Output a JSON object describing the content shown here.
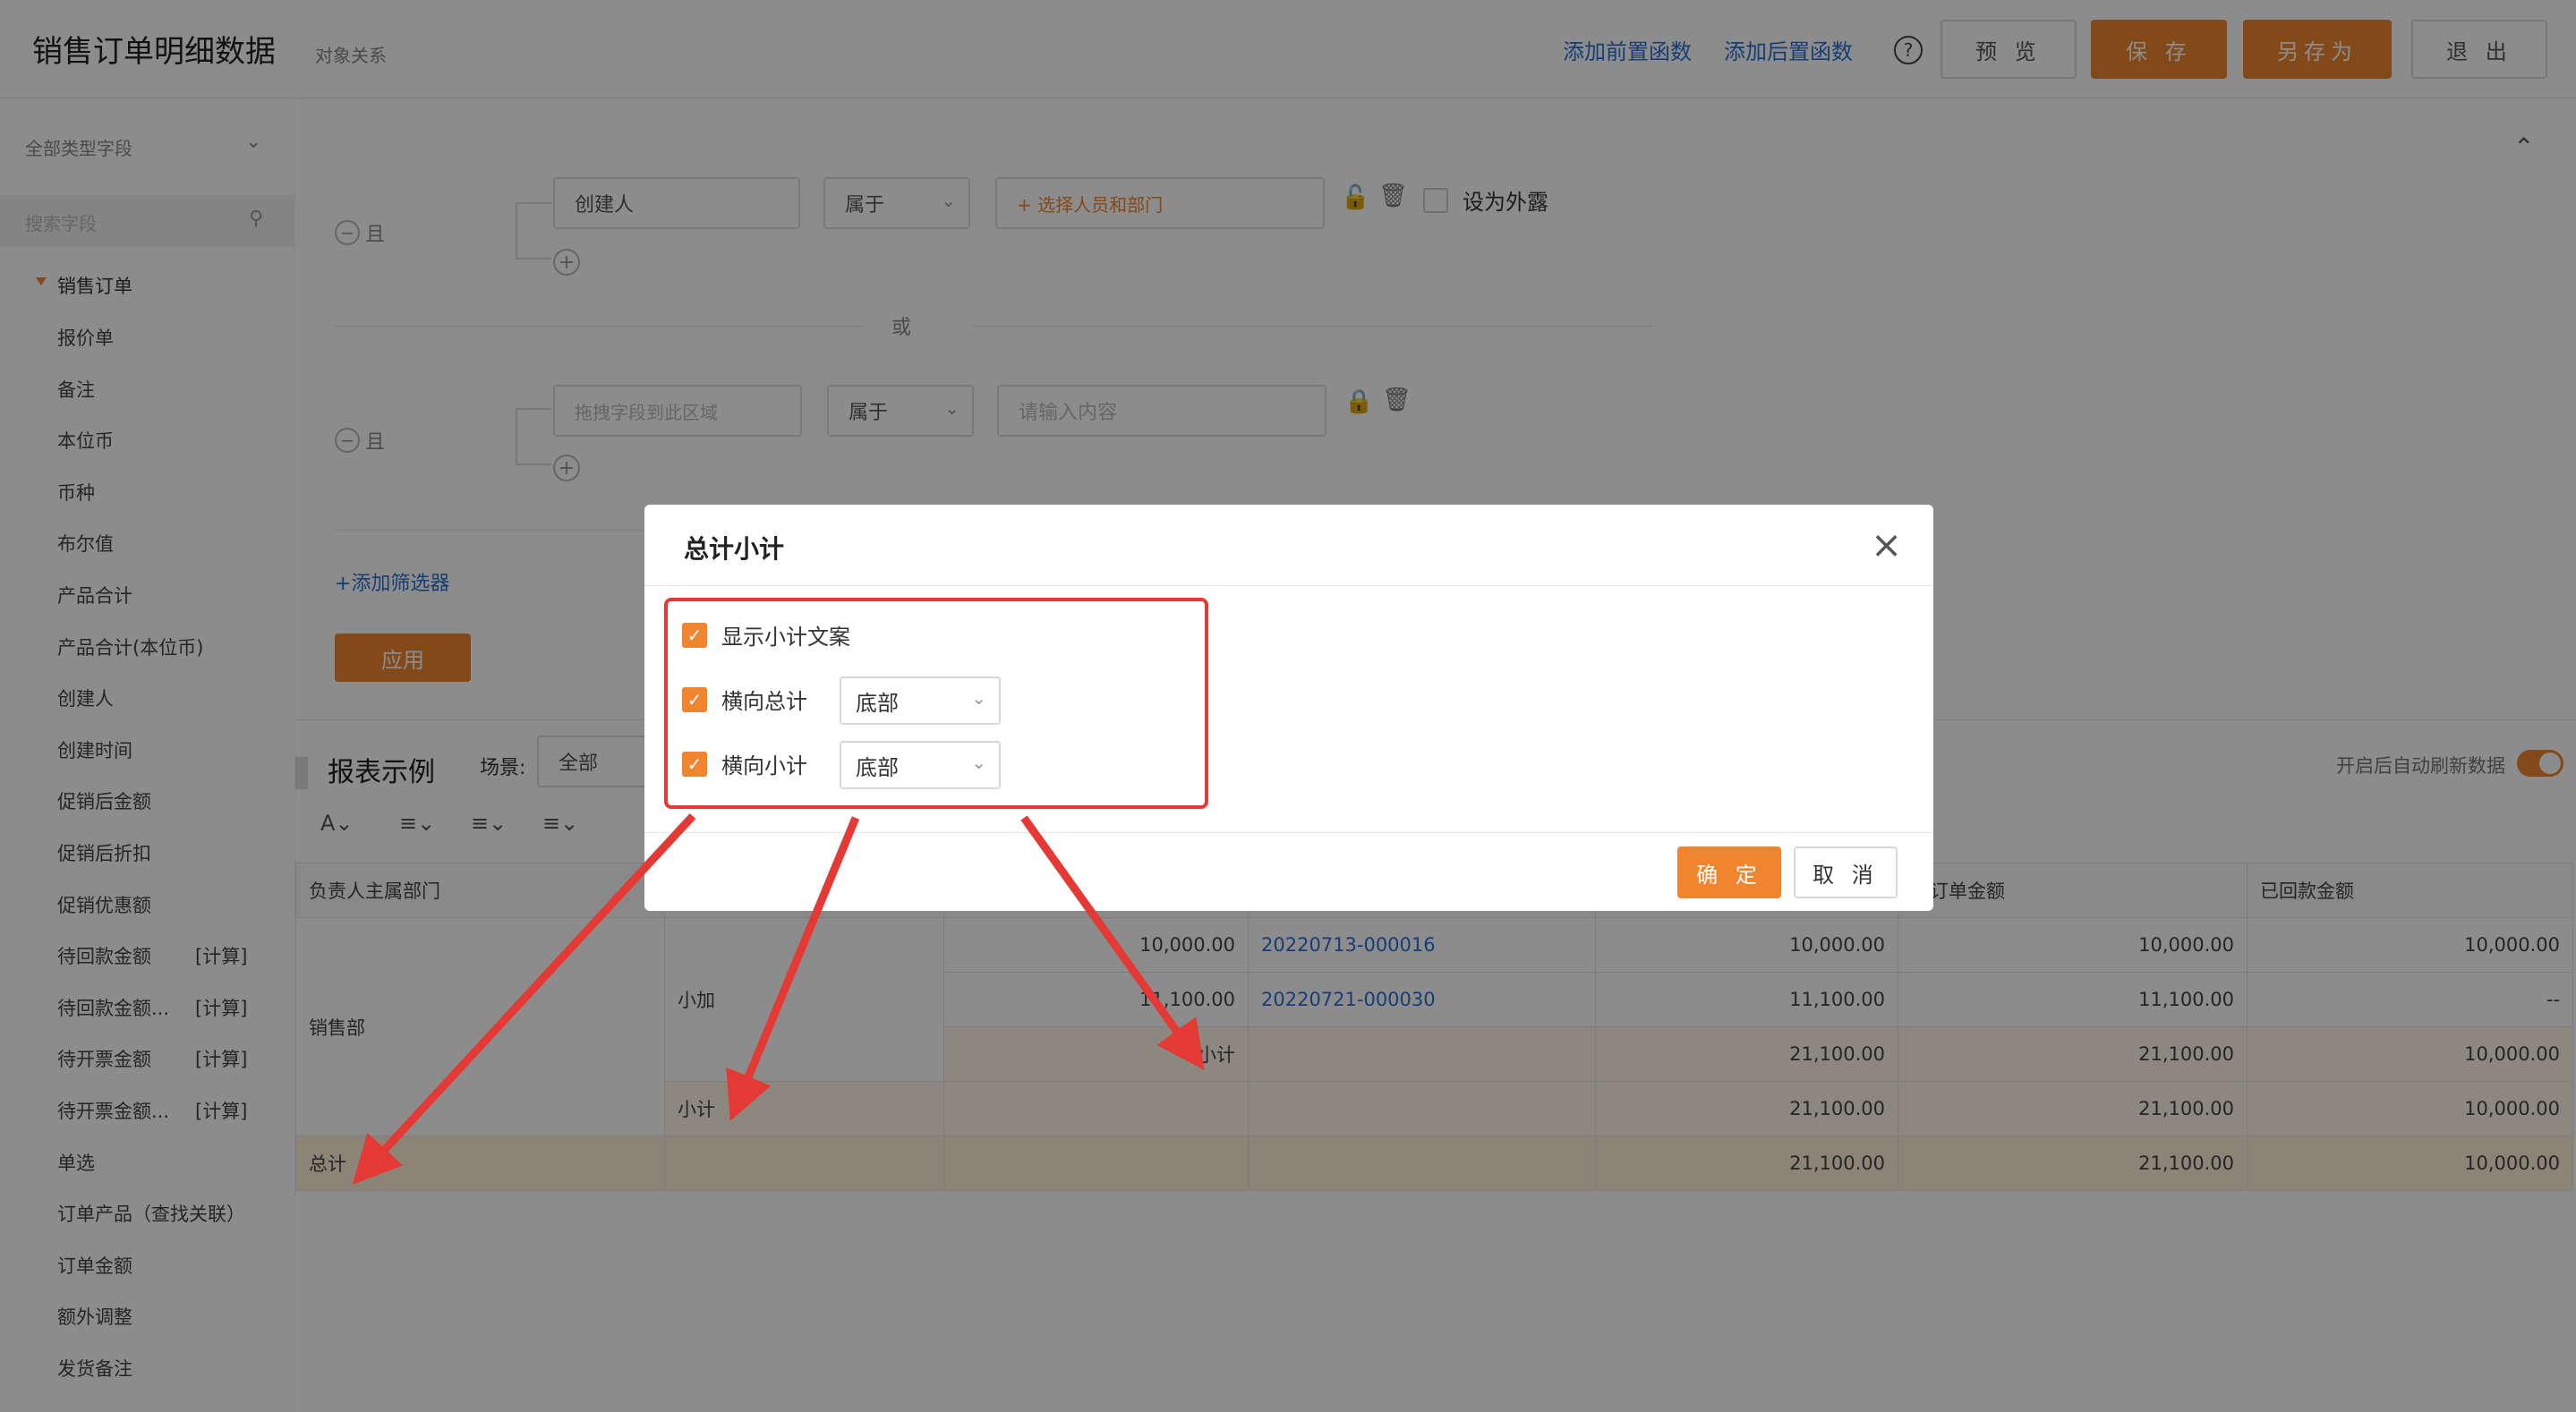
{
  "header": {
    "title": "销售订单明细数据",
    "subtitle": "对象关系",
    "add_pre_fn": "添加前置函数",
    "add_post_fn": "添加后置函数",
    "help": "?",
    "preview": "预 览",
    "save": "保 存",
    "save_as": "另存为",
    "exit": "退 出"
  },
  "sidebar": {
    "field_type": "全部类型字段",
    "search_placeholder": "搜索字段",
    "group": "销售订单",
    "items": [
      {
        "label": "报价单",
        "tag": ""
      },
      {
        "label": "备注",
        "tag": ""
      },
      {
        "label": "本位币",
        "tag": ""
      },
      {
        "label": "币种",
        "tag": ""
      },
      {
        "label": "布尔值",
        "tag": ""
      },
      {
        "label": "产品合计",
        "tag": ""
      },
      {
        "label": "产品合计(本位币)",
        "tag": ""
      },
      {
        "label": "创建人",
        "tag": ""
      },
      {
        "label": "创建时间",
        "tag": ""
      },
      {
        "label": "促销后金额",
        "tag": ""
      },
      {
        "label": "促销后折扣",
        "tag": ""
      },
      {
        "label": "促销优惠额",
        "tag": ""
      },
      {
        "label": "待回款金额",
        "tag": "[计算]"
      },
      {
        "label": "待回款金额...",
        "tag": "[计算]"
      },
      {
        "label": "待开票金额",
        "tag": "[计算]"
      },
      {
        "label": "待开票金额...",
        "tag": "[计算]"
      },
      {
        "label": "单选",
        "tag": ""
      },
      {
        "label": "订单产品（查找关联）",
        "tag": ""
      },
      {
        "label": "订单金额",
        "tag": ""
      },
      {
        "label": "额外调整",
        "tag": ""
      },
      {
        "label": "发货备注",
        "tag": ""
      }
    ]
  },
  "filter": {
    "and_label": "且",
    "or_label": "或",
    "row1": {
      "field": "创建人",
      "op": "属于",
      "value": "+ 选择人员和部门",
      "expose": "设为外露"
    },
    "row2": {
      "field_placeholder": "拖拽字段到此区域",
      "op": "属于",
      "value_placeholder": "请输入内容"
    },
    "add_filter": "+添加筛选器",
    "apply": "应用"
  },
  "report": {
    "title": "报表示例",
    "scene_label": "场景:",
    "scene_value": "全部",
    "auto_refresh": "开启后自动刷新数据",
    "columns": [
      "负责人主属部门",
      "",
      "",
      "",
      "",
      "售订单金额",
      "已回款金额"
    ],
    "dept": "销售部",
    "person": "小加",
    "rows": [
      {
        "a": "10,000.00",
        "code": "20220713-000016",
        "b": "10,000.00",
        "c": "10,000.00",
        "d": "10,000.00"
      },
      {
        "a": "11,100.00",
        "code": "20220721-000030",
        "b": "11,100.00",
        "c": "11,100.00",
        "d": "--"
      }
    ],
    "subtotal_inner": {
      "label": "小计",
      "b": "21,100.00",
      "c": "21,100.00",
      "d": "10,000.00"
    },
    "subtotal_outer": {
      "label": "小计",
      "b": "21,100.00",
      "c": "21,100.00",
      "d": "10,000.00"
    },
    "total": {
      "label": "总计",
      "b": "21,100.00",
      "c": "21,100.00",
      "d": "10,000.00"
    }
  },
  "modal": {
    "title": "总计小计",
    "show_subtotal_text": "显示小计文案",
    "h_total": "横向总计",
    "h_total_pos": "底部",
    "h_subtotal": "横向小计",
    "h_subtotal_pos": "底部",
    "ok": "确 定",
    "cancel": "取 消"
  },
  "colors": {
    "accent": "#f0852d",
    "link": "#2b6fd6",
    "annotation": "#e53935"
  }
}
